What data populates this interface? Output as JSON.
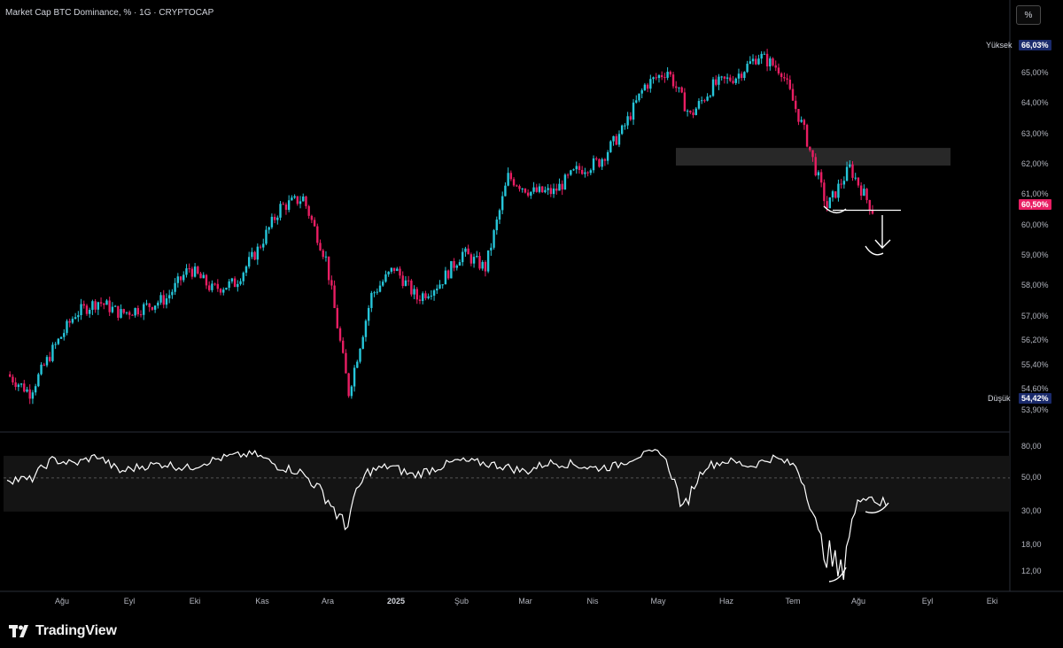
{
  "header": {
    "title": "Market Cap BTC Dominance, % · 1G · CRYPTOCAP",
    "scale_button": "%"
  },
  "price_axis": {
    "ticks": [
      "66,03%",
      "65,00%",
      "64,00%",
      "63,00%",
      "62,00%",
      "61,00%",
      "60,50%",
      "60,00%",
      "59,00%",
      "58,00%",
      "57,00%",
      "56,20%",
      "55,40%",
      "54,60%",
      "53,90%"
    ],
    "high_label": "Yüksek",
    "high_value": "66,03%",
    "low_label": "Düşük",
    "low_value": "54,42%",
    "last_value": "60,50%"
  },
  "rsi_axis": {
    "ticks": [
      "80,00",
      "50,00",
      "30,00",
      "18,00",
      "12,00"
    ]
  },
  "time_axis": {
    "labels": [
      "Ağu",
      "Eyl",
      "Eki",
      "Kas",
      "Ara",
      "2025",
      "Şub",
      "Mar",
      "Nis",
      "May",
      "Haz",
      "Tem",
      "Ağu",
      "Eyl",
      "Eki"
    ]
  },
  "footer": {
    "brand": "TradingView"
  },
  "colors": {
    "up": "#26c6da",
    "down": "#e91e63",
    "background": "#000000",
    "last_price_tag": "#e91e63",
    "hi_lo_tag": "#1a2a6c",
    "rsi_line": "#ffffff"
  },
  "chart_data": [
    {
      "type": "line",
      "subtype": "candlestick",
      "title": "Market Cap BTC Dominance, % · 1G · CRYPTOCAP",
      "xlabel": "",
      "ylabel": "",
      "ylim": [
        53.9,
        66.2
      ],
      "x": [
        "Jul 20",
        "Aug 1",
        "Aug 10",
        "Aug 20",
        "Sep 1",
        "Sep 10",
        "Sep 20",
        "Oct 1",
        "Oct 10",
        "Oct 20",
        "Nov 1",
        "Nov 10",
        "Nov 20",
        "Dec 1",
        "Dec 10",
        "Dec 20",
        "Jan 1",
        "Jan 10",
        "Jan 20",
        "Feb 1",
        "Feb 10",
        "Feb 20",
        "Mar 1",
        "Mar 10",
        "Mar 20",
        "Apr 1",
        "Apr 10",
        "Apr 20",
        "May 1",
        "May 10",
        "May 20",
        "Jun 1",
        "Jun 10",
        "Jun 20",
        "Jul 1",
        "Jul 10",
        "Jul 20",
        "Aug 1",
        "Aug 6"
      ],
      "series": [
        {
          "values": [
            55.1,
            54.5,
            55.9,
            57.1,
            57.5,
            57.1,
            57.3,
            57.6,
            58.6,
            57.9,
            58.1,
            59.2,
            60.6,
            60.9,
            58.9,
            54.5,
            57.7,
            58.6,
            57.6,
            58.1,
            59.1,
            58.6,
            61.6,
            61.1,
            61.1,
            61.8,
            62.1,
            63.1,
            64.6,
            65.1,
            63.6,
            64.6,
            64.9,
            65.6,
            65.1,
            63.1,
            60.6,
            61.9,
            60.5
          ]
        }
      ],
      "annotations": [
        "Yüksek 66,03%",
        "Düşük 54,42%",
        "60,50%",
        "resistance zone ~62,00–62,55%"
      ]
    },
    {
      "type": "line",
      "title": "",
      "ylim": [
        10,
        85
      ],
      "y_ticks": [
        80,
        50,
        30,
        18,
        12
      ],
      "x": [
        "Jul 20",
        "Aug 1",
        "Aug 10",
        "Aug 20",
        "Sep 1",
        "Sep 10",
        "Sep 20",
        "Oct 1",
        "Oct 10",
        "Oct 20",
        "Nov 1",
        "Nov 10",
        "Nov 20",
        "Dec 1",
        "Dec 10",
        "Dec 20",
        "Jan 1",
        "Jan 10",
        "Jan 20",
        "Feb 1",
        "Feb 10",
        "Feb 20",
        "Mar 1",
        "Mar 10",
        "Mar 20",
        "Apr 1",
        "Apr 10",
        "Apr 20",
        "May 1",
        "May 10",
        "May 20",
        "Jun 1",
        "Jun 10",
        "Jun 20",
        "Jul 1",
        "Jul 10",
        "Jul 20",
        "Jul 25",
        "Aug 1",
        "Aug 6"
      ],
      "series": [
        {
          "values": [
            50,
            48,
            66,
            62,
            70,
            55,
            60,
            62,
            58,
            65,
            70,
            72,
            60,
            55,
            40,
            23,
            55,
            60,
            52,
            58,
            65,
            63,
            60,
            55,
            63,
            62,
            58,
            60,
            70,
            75,
            30,
            60,
            65,
            60,
            68,
            60,
            20,
            11,
            40,
            33
          ]
        }
      ]
    }
  ]
}
